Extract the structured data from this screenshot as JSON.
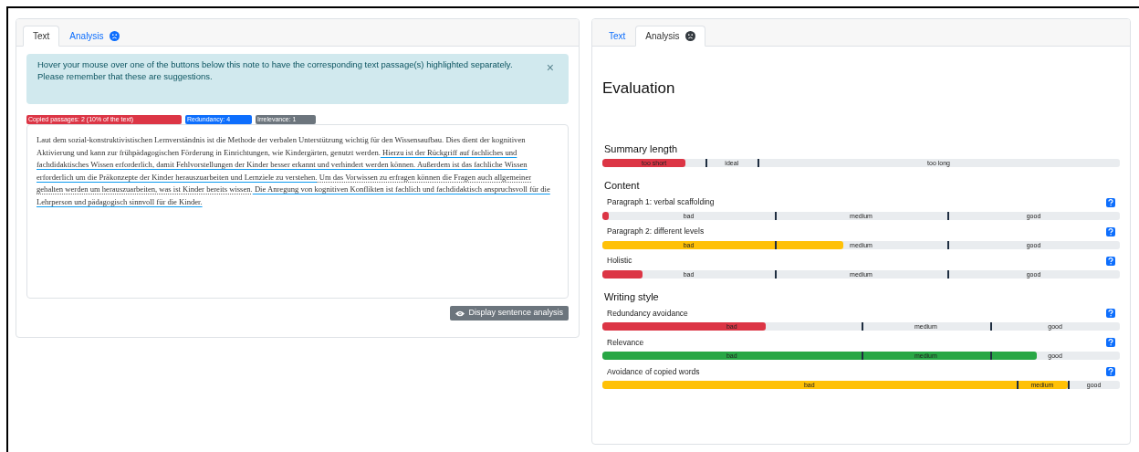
{
  "left_panel": {
    "tabs": [
      {
        "label": "Text",
        "selected": true
      },
      {
        "label": "Analysis",
        "selected": false
      }
    ],
    "alert": {
      "lines": [
        "Hover your mouse over one of the buttons below this note to have the corresponding text passage(s) highlighted separately.",
        "Please remember that these are suggestions."
      ],
      "close": "×"
    },
    "badges": [
      {
        "label": "Copied passages: 2 (10% of the text)",
        "color": "#dc3545"
      },
      {
        "label": "Redundancy: 4",
        "color": "#0d6efd"
      },
      {
        "label": "Irrelevance: 1",
        "color": "#6c757d"
      }
    ],
    "passages": [
      {
        "kind": "plain",
        "text": "Laut dem sozial-konstruktivistischen Lernverständnis ist die Methode der verbalen Unterstützung wichtig für den Wissensaufbau. Dies dient der kognitiven Aktivierung und kann zur frühpädagogischen Förderung in Einrichtungen, wie Kindergärten, genutzt werden."
      },
      {
        "kind": "redundant",
        "text": " Hierzu ist der Rückgriff auf fachliches und fachdidaktisches Wissen erforderlich, damit Fehlvorstellungen der Kinder besser erkannt und verhindert werden können."
      },
      {
        "kind": "redundant",
        "text": " Außerdem ist das fachliche Wissen erforderlich um die Präkonzepte der Kinder herauszuarbeiten und Lernziele zu verstehen."
      },
      {
        "kind": "irrelevant",
        "text": " Um das Vorwissen zu erfragen können die Fragen auch allgemeiner gehalten werden um herauszuarbeiten, was ist Kinder bereits wissen."
      },
      {
        "kind": "redundant",
        "text": " Die Anregung von kognitiven Konflikten ist fachlich und fachdidaktisch anspruchsvoll für die Lehrperson und pädagogisch sinnvoll für die Kinder."
      }
    ],
    "button": "Display sentence analysis"
  },
  "right_panel": {
    "tabs": [
      {
        "label": "Text",
        "selected": false
      },
      {
        "label": "Analysis",
        "selected": true
      }
    ],
    "title": "Evaluation",
    "sections": [
      {
        "heading": "Summary length",
        "metrics": [
          {
            "kind": "length",
            "help": false,
            "level": 0.16,
            "color": "#dc3545",
            "segments": [
              "too short",
              "ideal",
              "too long"
            ]
          }
        ]
      },
      {
        "heading": "Content",
        "metrics": [
          {
            "kind": "thirds",
            "label": "Paragraph 1: verbal scaffolding",
            "help": true,
            "level": 0.012,
            "color": "#dc3545",
            "segments": [
              "bad",
              "medium",
              "good"
            ]
          },
          {
            "kind": "thirds",
            "label": "Paragraph 2: different levels",
            "help": true,
            "level": 0.465,
            "color": "#ffc107",
            "segments": [
              "bad",
              "medium",
              "good"
            ]
          },
          {
            "kind": "thirds",
            "label": "Holistic",
            "help": true,
            "level": 0.078,
            "color": "#dc3545",
            "segments": [
              "bad",
              "medium",
              "good"
            ]
          }
        ]
      },
      {
        "heading": "Writing style",
        "metrics": [
          {
            "kind": "style",
            "label": "Redundancy avoidance",
            "help": true,
            "level": 0.315,
            "color": "#dc3545",
            "segments": [
              "bad",
              "medium",
              "good"
            ]
          },
          {
            "kind": "style",
            "label": "Relevance",
            "help": true,
            "level": 0.84,
            "color": "#28a745",
            "segments": [
              "bad",
              "medium",
              "good"
            ]
          },
          {
            "kind": "copied",
            "label": "Avoidance of copied words",
            "help": true,
            "level": 0.9,
            "color": "#ffc107",
            "segments": [
              "bad",
              "medium",
              "good"
            ]
          }
        ]
      }
    ]
  }
}
